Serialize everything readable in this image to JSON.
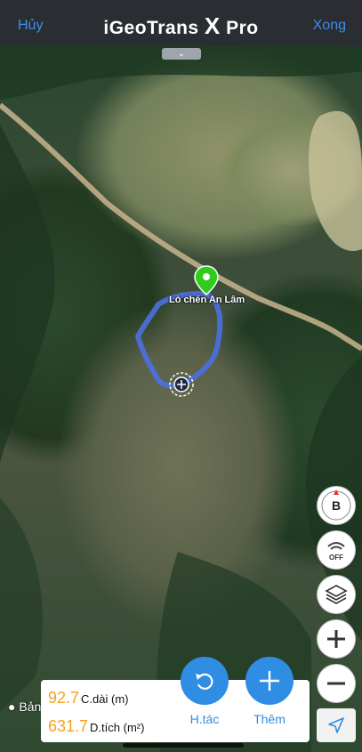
{
  "header": {
    "cancel_label": "Hủy",
    "title_main": "iGeoTrans ",
    "title_x": "X",
    "title_pro": " Pro",
    "done_label": "Xong"
  },
  "map": {
    "handle_icon": "chevron-down-icon",
    "marker_label": "Lò chén An Lâm",
    "attribution": "Bản"
  },
  "controls": {
    "compass_letter": "B",
    "tracking_label": "OFF"
  },
  "measurements": {
    "length_value": "92.7",
    "length_label": "C.dài (m)",
    "area_value": "631.7",
    "area_label": "D.tích (m²)"
  },
  "actions": {
    "undo_label": "H.tác",
    "add_label": "Thêm"
  },
  "colors": {
    "accent": "#2f8de4",
    "value": "#f3a21c",
    "polygon": "#4c6fe0",
    "pin": "#2ecc1b"
  }
}
